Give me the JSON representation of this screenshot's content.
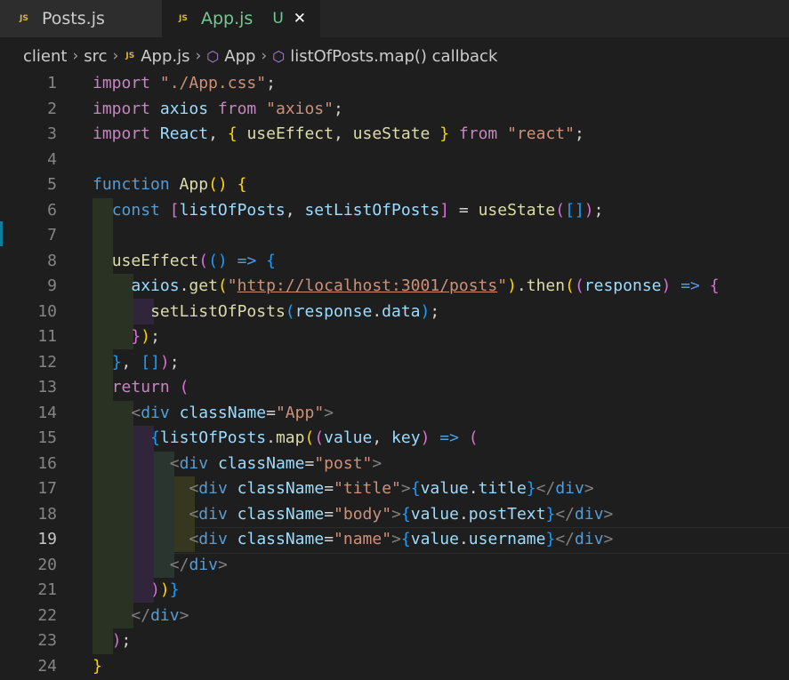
{
  "tabs": [
    {
      "icon": "JS",
      "label": "Posts.js"
    },
    {
      "icon": "JS",
      "label": "App.js",
      "status": "U",
      "close": "✕"
    }
  ],
  "breadcrumb": [
    "client",
    "src",
    "App.js",
    "App",
    "listOfPosts.map() callback"
  ],
  "breadcrumb_sep": "›",
  "line_numbers": [
    "1",
    "2",
    "3",
    "4",
    "5",
    "6",
    "7",
    "8",
    "9",
    "10",
    "11",
    "12",
    "13",
    "14",
    "15",
    "16",
    "17",
    "18",
    "19",
    "20",
    "21",
    "22",
    "23",
    "24"
  ],
  "active_line": "19",
  "code_lines": [
    "import \"./App.css\";",
    "import axios from \"axios\";",
    "import React, { useEffect, useState } from \"react\";",
    "",
    "function App() {",
    "  const [listOfPosts, setListOfPosts] = useState([]);",
    "",
    "  useEffect(() => {",
    "    axios.get(\"http://localhost:3001/posts\").then((response) => {",
    "      setListOfPosts(response.data);",
    "    });",
    "  }, []);",
    "  return (",
    "    <div className=\"App\">",
    "      {listOfPosts.map((value, key) => (",
    "        <div className=\"post\">",
    "          <div className=\"title\">{value.title}</div>",
    "          <div className=\"body\">{value.postText}</div>",
    "          <div className=\"name\">{value.username}</div>",
    "        </div>",
    "      ))}",
    "    </div>",
    "  );",
    "}"
  ],
  "colors": {
    "keyword": "#569cd6",
    "control": "#c586c0",
    "string": "#ce9178",
    "variable": "#9cdcfe",
    "function": "#dcdcaa",
    "class": "#4ec9b0",
    "bracket1": "#ffd700",
    "bracket2": "#da70d6",
    "bracket3": "#179fff"
  }
}
